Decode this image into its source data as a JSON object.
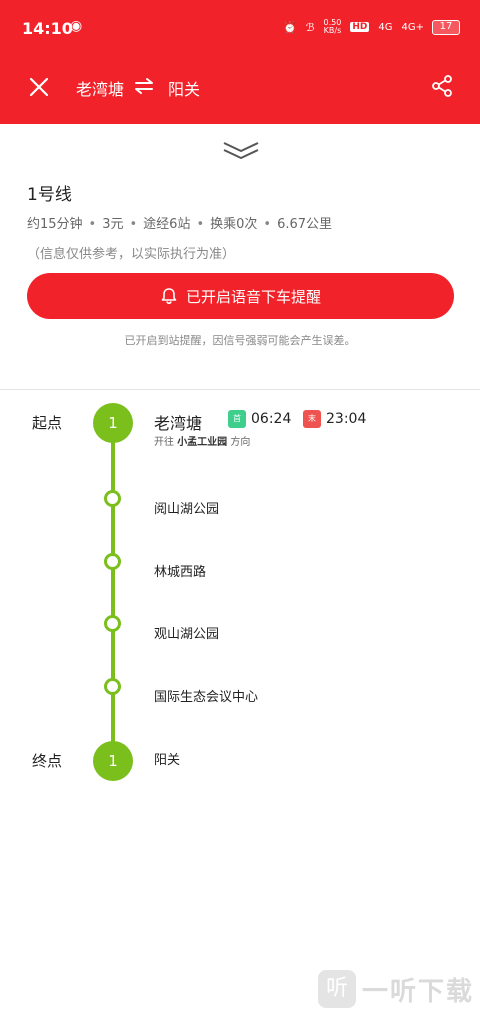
{
  "status_bar": {
    "time": "14:10",
    "net_speed_value": "0.50",
    "net_speed_unit": "KB/s",
    "hd": "HD",
    "signal1": "4G",
    "signal2": "4G+",
    "battery": "17"
  },
  "header": {
    "from": "老湾塘",
    "to": "阳关"
  },
  "route": {
    "line_name": "1号线",
    "duration": "约15分钟",
    "fare": "3元",
    "stops": "途经6站",
    "transfers": "换乘0次",
    "distance": "6.67公里",
    "disclaimer": "（信息仅供参考，以实际执行为准）",
    "voice_button_label": "已开启语音下车提醒",
    "voice_note": "已开启到站提醒，因信号强弱可能会产生误差。"
  },
  "timeline": {
    "start_label": "起点",
    "end_label": "终点",
    "line_number": "1",
    "first_station": "老湾塘",
    "first_badge": "首",
    "first_time": "06:24",
    "last_badge": "末",
    "last_time": "23:04",
    "toward_prefix": "开往",
    "toward_station": "小孟工业园",
    "toward_suffix": "方向",
    "stations": [
      "阅山湖公园",
      "林城西路",
      "观山湖公园",
      "国际生态会议中心"
    ],
    "last_station": "阳关"
  },
  "watermark": {
    "logo": "听",
    "text": "一听下载"
  },
  "colors": {
    "brand_red": "#f2222a",
    "line_green": "#7bbf1c",
    "first_badge": "#3fce8c",
    "last_badge": "#ef5350"
  }
}
